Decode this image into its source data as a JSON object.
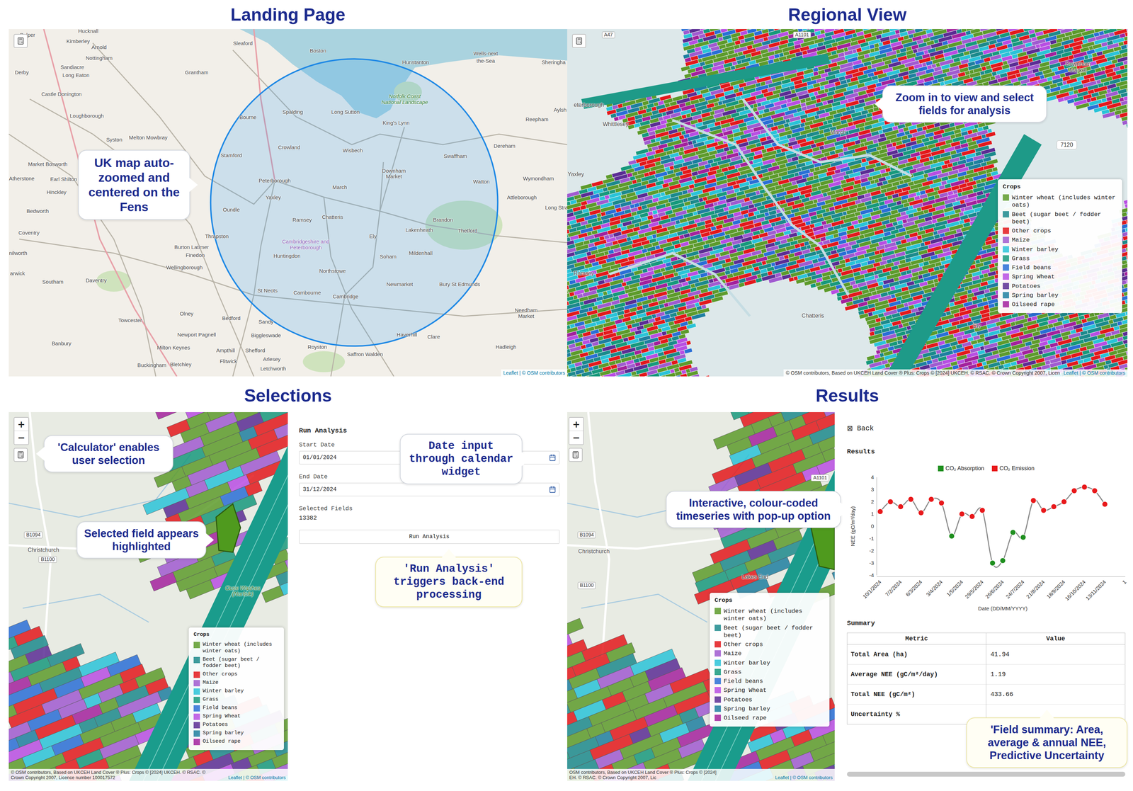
{
  "landing": {
    "title": "Landing Page",
    "callout": "UK map auto-zoomed and centered on the Fens",
    "attribution": "Leaflet | © OSM contributors",
    "places": [
      {
        "name": "Belper",
        "kind": "town"
      },
      {
        "name": "Hucknall",
        "kind": "town"
      },
      {
        "name": "Kimberley",
        "kind": "town"
      },
      {
        "name": "Arnold",
        "kind": "town"
      },
      {
        "name": "Nottingham",
        "kind": "town"
      },
      {
        "name": "Derby",
        "kind": "town"
      },
      {
        "name": "Sandiacre",
        "kind": "town"
      },
      {
        "name": "Long Eaton",
        "kind": "town"
      },
      {
        "name": "Castle Donington",
        "kind": "town"
      },
      {
        "name": "Loughborough",
        "kind": "town"
      },
      {
        "name": "Syston",
        "kind": "town"
      },
      {
        "name": "Melton Mowbray",
        "kind": "town"
      },
      {
        "name": "Grantham",
        "kind": "town"
      },
      {
        "name": "Sleaford",
        "kind": "town"
      },
      {
        "name": "Boston",
        "kind": "town"
      },
      {
        "name": "Hunstanton",
        "kind": "town"
      },
      {
        "name": "Wells-next",
        "kind": "town"
      },
      {
        "name": "the-Sea",
        "kind": "town"
      },
      {
        "name": "Sheringha",
        "kind": "town"
      },
      {
        "name": "Norfolk Coast National Landscape",
        "kind": "park"
      },
      {
        "name": "Aylsh",
        "kind": "town"
      },
      {
        "name": "Reepham",
        "kind": "town"
      },
      {
        "name": "Spalding",
        "kind": "town"
      },
      {
        "name": "Long Sutton",
        "kind": "town"
      },
      {
        "name": "Bourne",
        "kind": "town"
      },
      {
        "name": "King's Lynn",
        "kind": "town"
      },
      {
        "name": "Stamford",
        "kind": "town"
      },
      {
        "name": "Crowland",
        "kind": "town"
      },
      {
        "name": "Wisbech",
        "kind": "town"
      },
      {
        "name": "Dereham",
        "kind": "town"
      },
      {
        "name": "Swaffham",
        "kind": "town"
      },
      {
        "name": "Market Bosworth",
        "kind": "town"
      },
      {
        "name": "Downham Market",
        "kind": "twoline"
      },
      {
        "name": "Atherstone",
        "kind": "town"
      },
      {
        "name": "Earl Shilton",
        "kind": "town"
      },
      {
        "name": "Peterborough",
        "kind": "town"
      },
      {
        "name": "Watton",
        "kind": "town"
      },
      {
        "name": "Wymondham",
        "kind": "town"
      },
      {
        "name": "March",
        "kind": "town"
      },
      {
        "name": "Hinckley",
        "kind": "town"
      },
      {
        "name": "Yaxley",
        "kind": "town"
      },
      {
        "name": "Attleborough",
        "kind": "town"
      },
      {
        "name": "Long Stra",
        "kind": "town"
      },
      {
        "name": "Bedworth",
        "kind": "town"
      },
      {
        "name": "Oundle",
        "kind": "town"
      },
      {
        "name": "Chatteris",
        "kind": "town"
      },
      {
        "name": "Ramsey",
        "kind": "town"
      },
      {
        "name": "Brandon",
        "kind": "town"
      },
      {
        "name": "Lakenheath",
        "kind": "town"
      },
      {
        "name": "Thetford",
        "kind": "town"
      },
      {
        "name": "Coventry",
        "kind": "town"
      },
      {
        "name": "Ely",
        "kind": "town"
      },
      {
        "name": "Thrapston",
        "kind": "town"
      },
      {
        "name": "Cambridgeshire and Peterborough",
        "kind": "region"
      },
      {
        "name": "Burton Latimer",
        "kind": "town"
      },
      {
        "name": "nilworth",
        "kind": "town"
      },
      {
        "name": "Mildenhall",
        "kind": "town"
      },
      {
        "name": "Finedon",
        "kind": "town"
      },
      {
        "name": "Huntingdon",
        "kind": "town"
      },
      {
        "name": "Soham",
        "kind": "town"
      },
      {
        "name": "Wellingborough",
        "kind": "town"
      },
      {
        "name": "Northstowe",
        "kind": "town"
      },
      {
        "name": "arwick",
        "kind": "town"
      },
      {
        "name": "Daventry",
        "kind": "town"
      },
      {
        "name": "Southam",
        "kind": "town"
      },
      {
        "name": "Newmarket",
        "kind": "town"
      },
      {
        "name": "Bury St Edmunds",
        "kind": "town"
      },
      {
        "name": "St Neots",
        "kind": "town"
      },
      {
        "name": "Cambourne",
        "kind": "town"
      },
      {
        "name": "Cambridge",
        "kind": "town"
      },
      {
        "name": "Needham Market",
        "kind": "twoline"
      },
      {
        "name": "Olney",
        "kind": "town"
      },
      {
        "name": "Bedford",
        "kind": "town"
      },
      {
        "name": "Towcester",
        "kind": "town"
      },
      {
        "name": "Sandy",
        "kind": "town"
      },
      {
        "name": "Newport Pagnell",
        "kind": "town"
      },
      {
        "name": "Biggleswade",
        "kind": "town"
      },
      {
        "name": "Haverhill",
        "kind": "town"
      },
      {
        "name": "Clare",
        "kind": "town"
      },
      {
        "name": "Banbury",
        "kind": "town"
      },
      {
        "name": "Royston",
        "kind": "town"
      },
      {
        "name": "Hadleigh",
        "kind": "town"
      },
      {
        "name": "Milton Keynes",
        "kind": "town"
      },
      {
        "name": "Ampthill",
        "kind": "town"
      },
      {
        "name": "Shefford",
        "kind": "town"
      },
      {
        "name": "Saffron Walden",
        "kind": "town"
      },
      {
        "name": "Arlesey",
        "kind": "town"
      },
      {
        "name": "Flitwick",
        "kind": "town"
      },
      {
        "name": "Bletchley",
        "kind": "town"
      },
      {
        "name": "Buckingham",
        "kind": "town"
      },
      {
        "name": "Letchworth",
        "kind": "town"
      }
    ]
  },
  "regional": {
    "title": "Regional View",
    "callout": "Zoom in to view and select fields for analysis",
    "badge": "7120",
    "attribution": "© OSM contributors, Based on UKCEH Land Cover ® Plus: Crops © [2024] UKCEH. © RSAC. © Crown Copyright 2007, Licen",
    "attribution_end": "Leaflet | © OSM contributors",
    "places": [
      {
        "name": "A47",
        "kind": "road"
      },
      {
        "name": "A1101",
        "kind": "road"
      },
      {
        "name": "Downham Market",
        "kind": "twoline"
      },
      {
        "name": "eterborough",
        "kind": "town"
      },
      {
        "name": "Whittlesey",
        "kind": "town"
      },
      {
        "name": "March",
        "kind": "town"
      },
      {
        "name": "Yaxley",
        "kind": "town"
      },
      {
        "name": "Ramsey",
        "kind": "town"
      },
      {
        "name": "Chatteris",
        "kind": "town"
      },
      {
        "name": "Ely",
        "kind": "town"
      }
    ]
  },
  "legend": {
    "title": "Crops",
    "items": [
      {
        "label": "Winter wheat (includes winter oats)",
        "color": "#5d9b2c"
      },
      {
        "label": "Beet (sugar beet / fodder beet)",
        "color": "#1c8a8c"
      },
      {
        "label": "Other crops",
        "color": "#e3191c"
      },
      {
        "label": "Maize",
        "color": "#a05bd0"
      },
      {
        "label": "Winter barley",
        "color": "#2ac3d8"
      },
      {
        "label": "Grass",
        "color": "#17997c"
      },
      {
        "label": "Field beans",
        "color": "#2a6fd6"
      },
      {
        "label": "Spring Wheat",
        "color": "#b84ee3"
      },
      {
        "label": "Potatoes",
        "color": "#5b2d94"
      },
      {
        "label": "Spring barley",
        "color": "#1e7fa0"
      },
      {
        "label": "Oilseed rape",
        "color": "#a3229d"
      }
    ]
  },
  "map_controls": {
    "zoom_in": "+",
    "zoom_out": "−"
  },
  "selections": {
    "title": "Selections",
    "calculator_callout": "'Calculator' enables user selection",
    "field_callout": "Selected field appears highlighted",
    "places": [
      {
        "name": "B1094",
        "kind": "road"
      },
      {
        "name": "Christchurch",
        "kind": "town"
      },
      {
        "name": "B1100",
        "kind": "road"
      },
      {
        "name": "Ouse Washes (Norfolk)",
        "kind": "park"
      }
    ],
    "attribution": [
      "© OSM contributors, Based on UKCEH Land Cover ® Plus: Crops © [2024] UKCEH. © RSAC. ©",
      "Crown Copyright 2007, Licence number 100017572"
    ],
    "attribution_end": "Leaflet | © OSM contributors",
    "form": {
      "heading": "Run Analysis",
      "fields": [
        {
          "label": "Start Date",
          "value": "01/01/2024"
        },
        {
          "label": "End Date",
          "value": "31/12/2024"
        }
      ],
      "selected_label": "Selected Fields",
      "selected_value": "13382",
      "button": "Run Analysis",
      "date_callout": "Date input through calendar widget",
      "button_callout": "'Run Analysis' triggers back-end processing"
    }
  },
  "results": {
    "title": "Results",
    "callout": "Interactive, colour-coded timeseries with pop-up option",
    "places": [
      {
        "name": "A1101",
        "kind": "road"
      },
      {
        "name": "B1094",
        "kind": "road"
      },
      {
        "name": "Christchurch",
        "kind": "town"
      },
      {
        "name": "B1100",
        "kind": "road"
      },
      {
        "name": "Lakes End",
        "kind": "town"
      }
    ],
    "attribution": [
      "OSM contributors, Based on UKCEH Land Cover ® Plus: Crops © [2024]",
      "EH. © RSAC. © Crown Copyright 2007, Lic"
    ],
    "attribution_end": "Leaflet | © OSM contributors",
    "back": {
      "icon": "⊠",
      "label": "Back"
    },
    "heading": "Results",
    "chart": {
      "legend": [
        {
          "label": "CO₂ Absorption",
          "color": "#1f8f1f"
        },
        {
          "label": "CO₂ Emission",
          "color": "#e8191b"
        }
      ],
      "y_label": "NEE (gC/m²/day)",
      "y_ticks": [
        "4",
        "3",
        "2",
        "1",
        "0",
        "-1",
        "-2",
        "-3",
        "-4"
      ],
      "x_label": "Date (DD/MM/YYYY)",
      "x_ticks": [
        "10/1/2024",
        "7/2/2024",
        "6/3/2024",
        "3/4/2024",
        "1/5/2024",
        "29/5/2024",
        "26/6/2024",
        "24/7/2024",
        "21/8/2024",
        "18/9/2024",
        "16/10/2024",
        "13/11/2024",
        "1"
      ],
      "values": [
        1.2,
        2.0,
        1.6,
        2.2,
        1.1,
        2.2,
        1.9,
        -0.8,
        1.0,
        0.8,
        1.3,
        -3.0,
        -2.8,
        -0.5,
        -0.9,
        2.1,
        1.3,
        1.6,
        2.0,
        2.9,
        3.2,
        2.9,
        1.8
      ]
    },
    "summary": {
      "heading": "Summary",
      "columns": [
        "Metric",
        "Value"
      ],
      "rows": [
        {
          "metric": "Total Area (ha)",
          "value": "41.94"
        },
        {
          "metric": "Average NEE (gC/m²/day)",
          "value": "1.19"
        },
        {
          "metric": "Total NEE (gC/m²)",
          "value": "433.66"
        },
        {
          "metric": "Uncertainty %",
          "value": ""
        }
      ]
    },
    "summary_callout": "'Field summary: Area, average & annual NEE, Predictive Uncertainty"
  }
}
